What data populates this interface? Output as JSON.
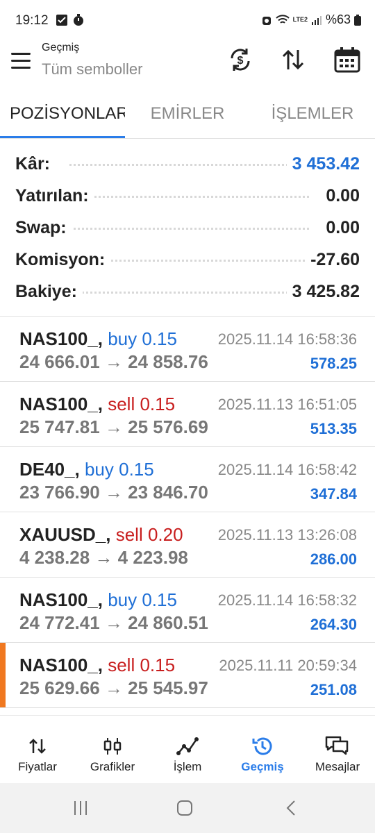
{
  "status": {
    "time": "19:12",
    "battery": "%63",
    "network": "LTE2"
  },
  "header": {
    "title": "Geçmiş",
    "subtitle": "Tüm semboller"
  },
  "tabs": [
    {
      "label": "POZİSYONLAR",
      "active": true
    },
    {
      "label": "EMİRLER",
      "active": false
    },
    {
      "label": "İŞLEMLER",
      "active": false
    }
  ],
  "summary": [
    {
      "label": "Kâr:",
      "value": "3 453.42",
      "highlight": true
    },
    {
      "label": "Yatırılan:",
      "value": "0.00"
    },
    {
      "label": "Swap:",
      "value": "0.00"
    },
    {
      "label": "Komisyon:",
      "value": "-27.60"
    },
    {
      "label": "Bakiye:",
      "value": "3 425.82"
    }
  ],
  "deals": [
    {
      "symbol": "NAS100_,",
      "side": "buy 0.15",
      "type": "buy",
      "date": "2025.11.14 16:58:36",
      "prices": "24 666.01 → 24 858.76",
      "profit": "578.25"
    },
    {
      "symbol": "NAS100_,",
      "side": "sell 0.15",
      "type": "sell",
      "date": "2025.11.13 16:51:05",
      "prices": "25 747.81 → 25 576.69",
      "profit": "513.35"
    },
    {
      "symbol": "DE40_,",
      "side": "buy 0.15",
      "type": "buy",
      "date": "2025.11.14 16:58:42",
      "prices": "23 766.90 → 23 846.70",
      "profit": "347.84"
    },
    {
      "symbol": "XAUUSD_,",
      "side": "sell 0.20",
      "type": "sell",
      "date": "2025.11.13 13:26:08",
      "prices": "4 238.28 → 4 223.98",
      "profit": "286.00"
    },
    {
      "symbol": "NAS100_,",
      "side": "buy 0.15",
      "type": "buy",
      "date": "2025.11.14 16:58:32",
      "prices": "24 772.41 → 24 860.51",
      "profit": "264.30"
    },
    {
      "symbol": "NAS100_,",
      "side": "sell 0.15",
      "type": "sell",
      "date": "2025.11.11 20:59:34",
      "prices": "25 629.66 → 25 545.97",
      "profit": "251.08",
      "marked": true
    }
  ],
  "nav": [
    {
      "label": "Fiyatlar",
      "icon": "quotes-icon"
    },
    {
      "label": "Grafikler",
      "icon": "charts-icon"
    },
    {
      "label": "İşlem",
      "icon": "trade-icon"
    },
    {
      "label": "Geçmiş",
      "icon": "history-icon",
      "active": true
    },
    {
      "label": "Mesajlar",
      "icon": "messages-icon"
    }
  ],
  "colors": {
    "accent": "#2b7de9",
    "buy": "#1f6fd6",
    "sell": "#c81e1e",
    "marker": "#f07820"
  }
}
